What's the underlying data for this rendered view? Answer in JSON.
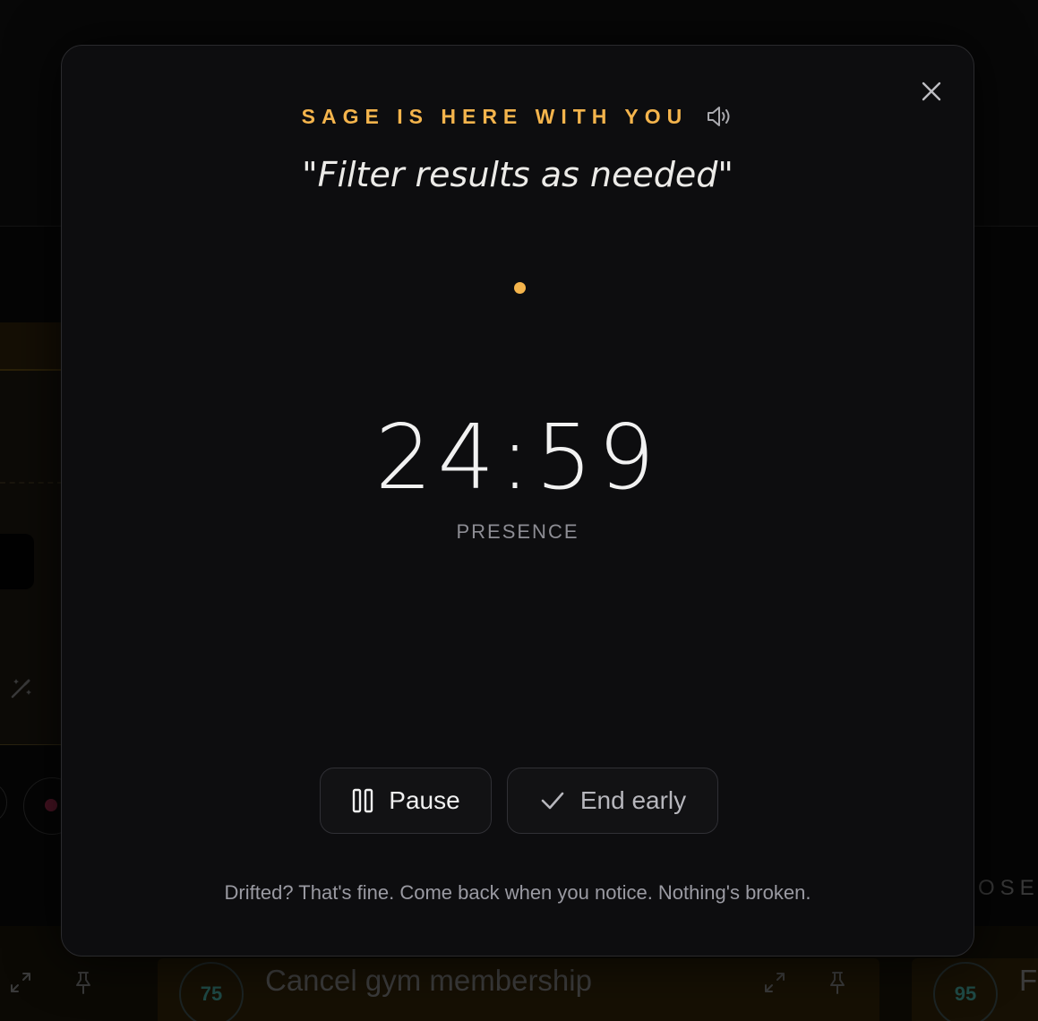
{
  "background": {
    "side_label": "OSE",
    "cards": [
      {
        "score": "75",
        "title": "Cancel gym membership"
      },
      {
        "score": "95",
        "title": "Fi"
      }
    ]
  },
  "modal": {
    "companion_label": "SAGE IS HERE WITH YOU",
    "task_quote": "\"Filter results as needed\"",
    "timer": "24:59",
    "mode_label": "PRESENCE",
    "pause_label": "Pause",
    "end_label": "End early",
    "footer_note": "Drifted? That's fine. Come back when you notice. Nothing's broken."
  },
  "icons": {
    "close": "close-icon",
    "sound": "speaker-icon",
    "pause": "pause-icon",
    "check": "check-icon",
    "expand": "expand-icon",
    "pin": "pin-icon",
    "wand": "magic-wand-icon"
  },
  "colors": {
    "accent": "#f4b44c",
    "modal_bg": "#0d0d0f",
    "text": "#f1f1f1",
    "muted": "#8d8d94"
  }
}
